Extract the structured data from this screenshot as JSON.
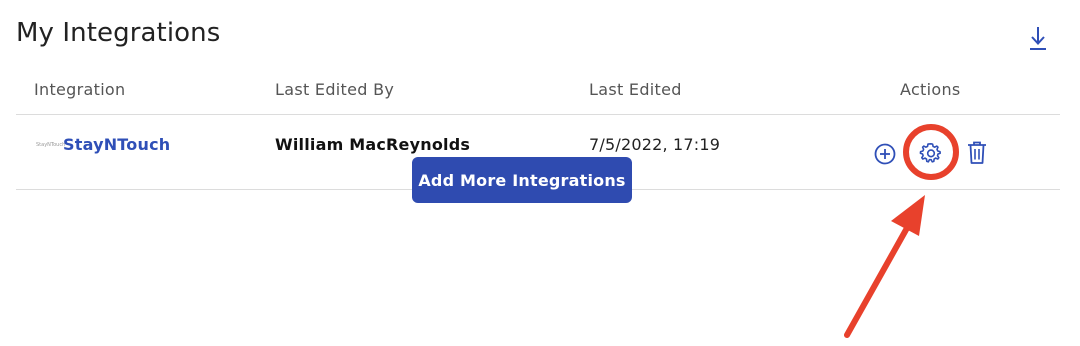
{
  "page": {
    "title": "My Integrations",
    "download_icon": "download-icon"
  },
  "table": {
    "columns": [
      "Integration",
      "Last Edited By",
      "Last Edited",
      "Actions"
    ],
    "rows": [
      {
        "logo_text": "StayNTouch",
        "integration": "StayNTouch",
        "last_edited_by": "William MacReynolds",
        "last_edited": "7/5/2022, 17:19",
        "actions": [
          "add-circle-icon",
          "gear-icon",
          "trash-icon"
        ]
      }
    ]
  },
  "footer": {
    "add_button_label": "Add More Integrations"
  },
  "colors": {
    "accent": "#2f4bb0",
    "link": "#2f4fb7",
    "annotation": "#e8412c",
    "divider": "#dcdcdc"
  }
}
